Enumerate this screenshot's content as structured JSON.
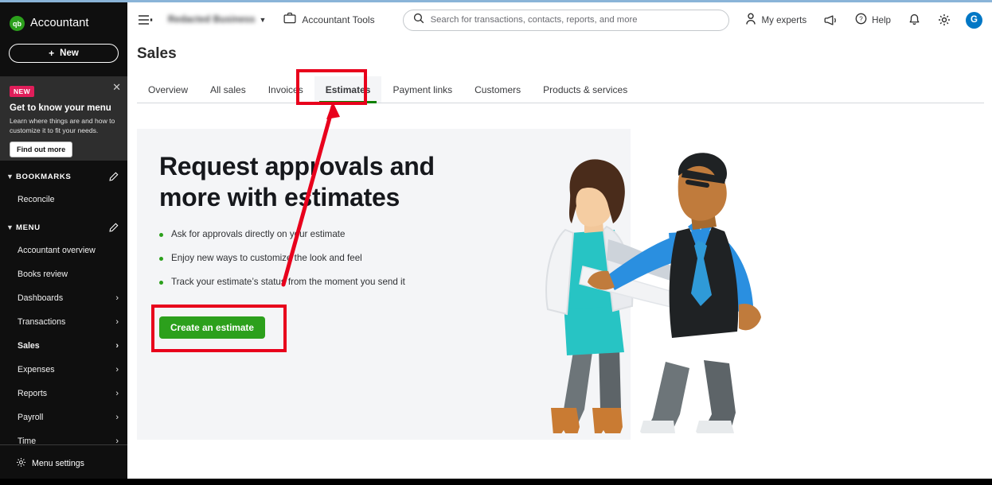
{
  "sidebar": {
    "brand": "Accountant",
    "logo_icon": "qb-logo-icon",
    "new_button": {
      "label": "New",
      "plus": "+"
    },
    "promo": {
      "badge": "NEW",
      "title": "Get to know your menu",
      "body": "Learn where things are and how to customize it to fit your needs.",
      "cta": "Find out more",
      "close_icon": "close-icon"
    },
    "sections": [
      {
        "title": "BOOKMARKS",
        "chevron": "⌄",
        "edit_icon": "pencil-icon",
        "items": [
          {
            "label": "Reconcile",
            "has_arrow": false,
            "bold": false
          }
        ]
      },
      {
        "title": "MENU",
        "chevron": "⌄",
        "edit_icon": "pencil-icon",
        "items": [
          {
            "label": "Accountant overview",
            "has_arrow": false,
            "bold": false
          },
          {
            "label": "Books review",
            "has_arrow": false,
            "bold": false
          },
          {
            "label": "Dashboards",
            "has_arrow": true,
            "bold": false
          },
          {
            "label": "Transactions",
            "has_arrow": true,
            "bold": false
          },
          {
            "label": "Sales",
            "has_arrow": true,
            "bold": true
          },
          {
            "label": "Expenses",
            "has_arrow": true,
            "bold": false
          },
          {
            "label": "Reports",
            "has_arrow": true,
            "bold": false
          },
          {
            "label": "Payroll",
            "has_arrow": true,
            "bold": false
          },
          {
            "label": "Time",
            "has_arrow": true,
            "bold": false
          }
        ]
      }
    ],
    "menu_settings": {
      "label": "Menu settings",
      "icon": "gear-icon"
    }
  },
  "topbar": {
    "hamburger_icon": "hamburger-menu-icon",
    "company_name": "Redacted Business",
    "company_chevron": "⌄",
    "accountant_tools": {
      "label": "Accountant Tools",
      "icon": "briefcase-icon"
    },
    "search": {
      "placeholder": "Search for transactions, contacts, reports, and more",
      "icon": "search-icon"
    },
    "my_experts": {
      "label": "My experts",
      "icon": "person-icon"
    },
    "megaphone_icon": "megaphone-icon",
    "help": {
      "label": "Help",
      "icon": "help-circle-icon"
    },
    "notifications_icon": "bell-icon",
    "settings_icon": "gear-icon",
    "avatar": {
      "initial": "G",
      "color": "#0077c5"
    }
  },
  "page": {
    "title": "Sales",
    "tabs": [
      {
        "label": "Overview",
        "active": false
      },
      {
        "label": "All sales",
        "active": false
      },
      {
        "label": "Invoices",
        "active": false
      },
      {
        "label": "Estimates",
        "active": true
      },
      {
        "label": "Payment links",
        "active": false
      },
      {
        "label": "Customers",
        "active": false
      },
      {
        "label": "Products & services",
        "active": false
      }
    ]
  },
  "hero": {
    "headline": "Request approvals and more with estimates",
    "bullets": [
      "Ask for approvals directly on your estimate",
      "Enjoy new ways to customize the look and feel",
      "Track your estimate’s status from the moment you send it"
    ],
    "cta_label": "Create an estimate",
    "illustration": "two-people-handshake-illustration"
  },
  "annotations": {
    "highlight_color": "#e8001c",
    "boxes": [
      "estimates-tab-highlight",
      "create-estimate-button-highlight"
    ],
    "arrow": "arrow-pointing-to-estimates-tab"
  },
  "colors": {
    "brand_green": "#2ca01c",
    "tab_underline_green": "#108000",
    "accent_blue": "#0077c5",
    "badge_pink": "#e01e5a",
    "sidebar_bg": "#0f0f0f",
    "hero_bg": "#f4f5f7"
  }
}
